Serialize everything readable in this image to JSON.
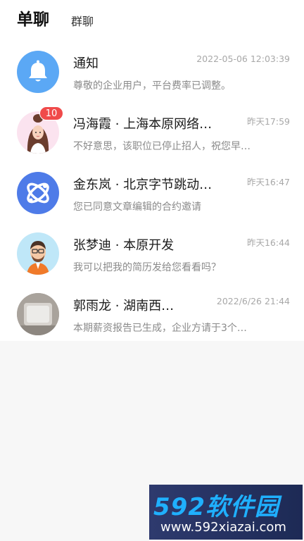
{
  "tabs": {
    "active": "单聊",
    "inactive": "群聊"
  },
  "conversations": [
    {
      "name": "通知",
      "time": "2022-05-06 12:03:39",
      "preview": "尊敬的企业用户，平台费率已调整。",
      "avatar": "bell-icon"
    },
    {
      "name": "冯海霞 · 上海本原网络…",
      "time": "昨天17:59",
      "preview": "不好意思，该职位已停止招人，祝您早…",
      "badge": "10",
      "avatar": "woman-avatar"
    },
    {
      "name": "金东岚 · 北京字节跳动…",
      "time": "昨天16:47",
      "preview": "您已同意文章编辑的合约邀请",
      "avatar": "bytedance-logo-icon"
    },
    {
      "name": "张梦迪 · 本原开发",
      "time": "昨天16:44",
      "preview": "我可以把我的简历发给您看看吗？",
      "avatar": "man-avatar"
    },
    {
      "name": "郭雨龙 · 湖南西…",
      "time": "2022/6/26 21:44",
      "preview": "本期薪资报告已生成，企业方请于3个…",
      "avatar": "photo-avatar"
    }
  ],
  "watermark": {
    "logo": "592软件园",
    "url": "www.592xiazai.com"
  },
  "colors": {
    "accent_blue": "#5ba8f5",
    "badge_red": "#f04a4a",
    "time_gray": "#a8a8a8"
  }
}
